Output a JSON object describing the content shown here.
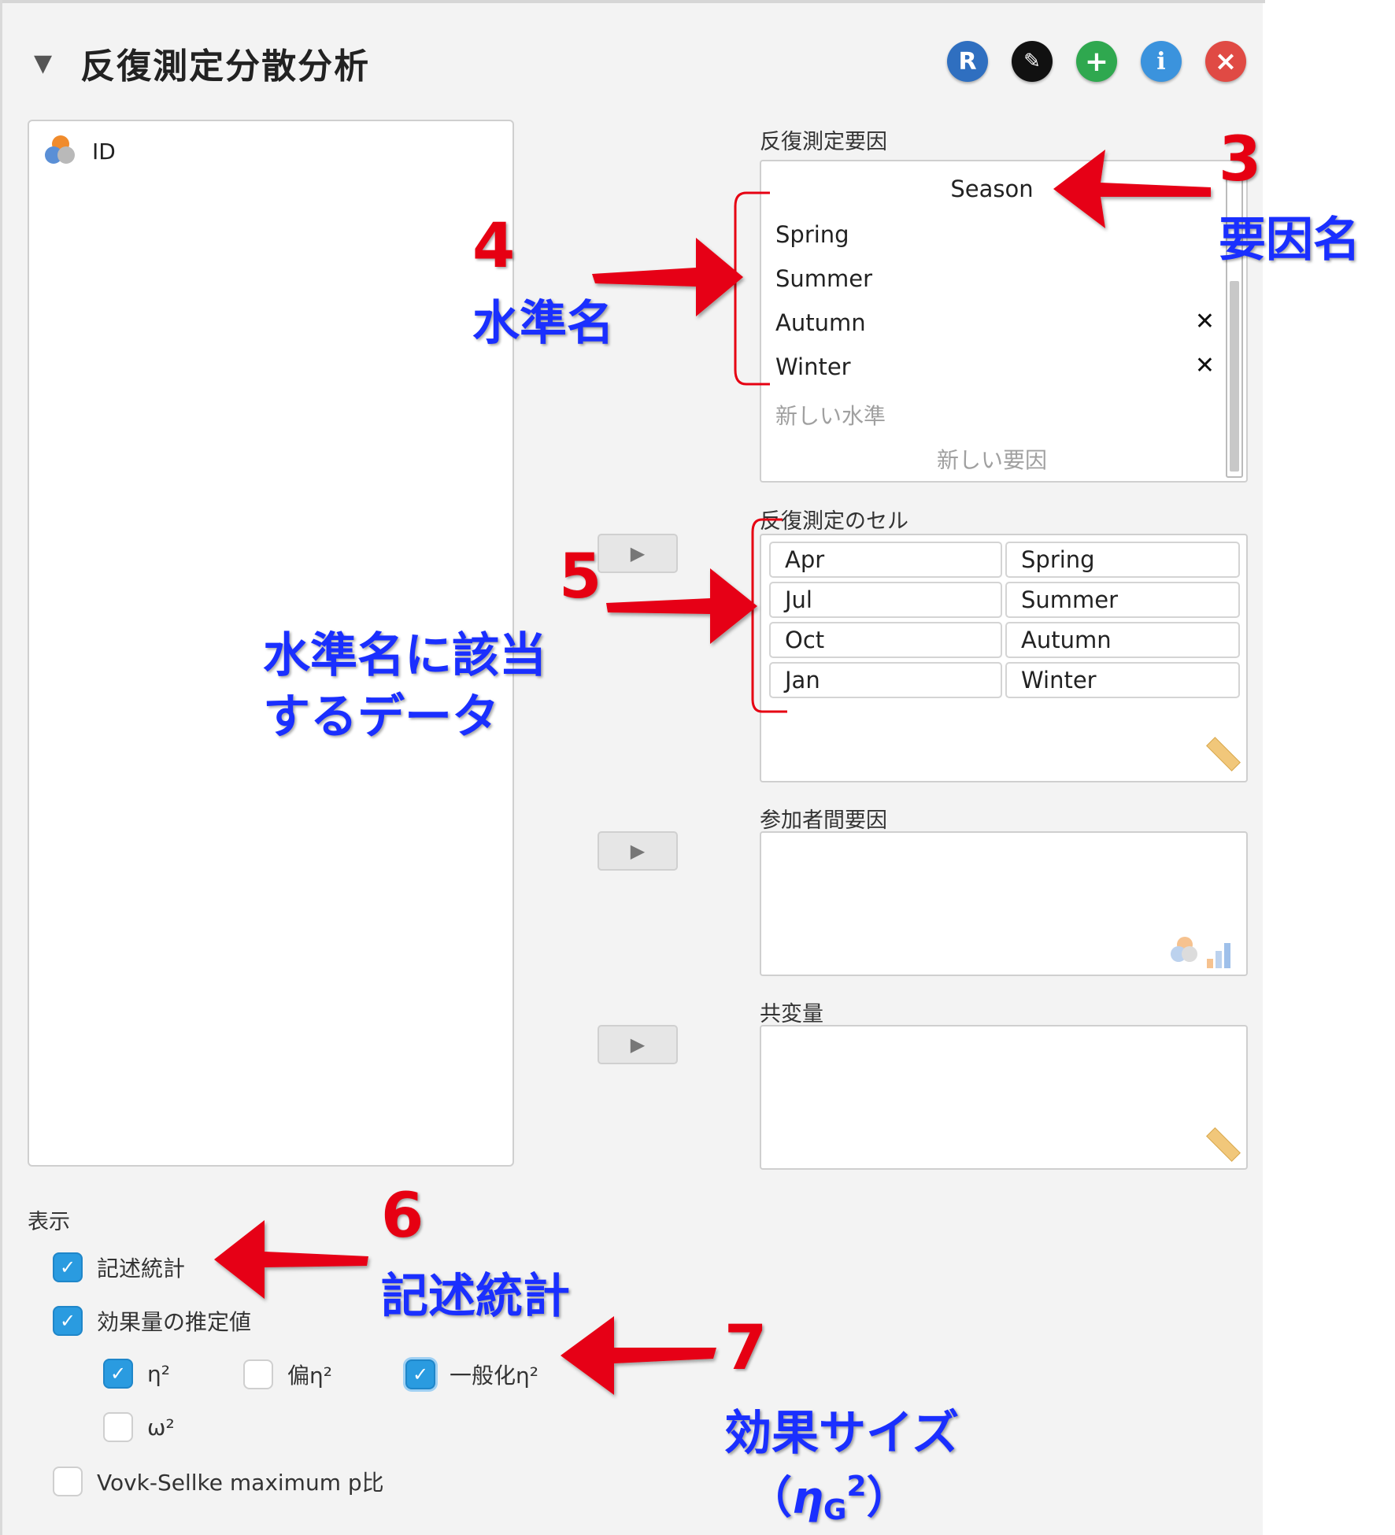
{
  "header": {
    "collapse_glyph": "▼",
    "title": "反復測定分散分析",
    "buttons": [
      {
        "label": "R",
        "icon": "r-syntax-icon",
        "color": "#2f6fc0"
      },
      {
        "label": "✎",
        "icon": "pencil-icon",
        "color": "#111111"
      },
      {
        "label": "+",
        "icon": "plus-icon",
        "color": "#2fa84f"
      },
      {
        "label": "i",
        "icon": "info-icon",
        "color": "#3b93dd"
      },
      {
        "label": "×",
        "icon": "close-icon",
        "color": "#e04a44"
      }
    ]
  },
  "variables": [
    {
      "name": "ID",
      "icon": "nominal-variable-icon"
    }
  ],
  "rm_factors": {
    "label": "反復測定要因",
    "factor_name": "Season",
    "levels": [
      "Spring",
      "Summer",
      "Autumn",
      "Winter"
    ],
    "remove_glyph": "✕",
    "new_level_placeholder": "新しい水準",
    "new_factor_placeholder": "新しい要因"
  },
  "rm_cells": {
    "label": "反復測定のセル",
    "rows": [
      {
        "data": "Apr",
        "level": "Spring"
      },
      {
        "data": "Jul",
        "level": "Summer"
      },
      {
        "data": "Oct",
        "level": "Autumn"
      },
      {
        "data": "Jan",
        "level": "Winter"
      }
    ]
  },
  "between_factors": {
    "label": "参加者間要因"
  },
  "covariates": {
    "label": "共変量"
  },
  "transfer_glyph": "▶",
  "display": {
    "label": "表示",
    "check_glyph": "✓",
    "descriptives": {
      "label": "記述統計",
      "checked": true
    },
    "effect_size": {
      "label": "効果量の推定値",
      "checked": true
    },
    "eta_sq": {
      "label": "η²",
      "checked": true
    },
    "partial_eta_sq": {
      "label": "偏η²",
      "checked": false
    },
    "general_eta_sq": {
      "label": "一般化η²",
      "checked": true
    },
    "omega_sq": {
      "label": "ω²",
      "checked": false
    },
    "vovk_sellke": {
      "label": "Vovk-Sellke maximum p比",
      "checked": false
    }
  },
  "annotations": {
    "n3": "3",
    "t3": "要因名",
    "n4": "4",
    "t4": "水準名",
    "n5": "5",
    "t5a": "水準名に該当",
    "t5b": "するデータ",
    "n6": "6",
    "t6": "記述統計",
    "n7": "7",
    "t7": "効果サイズ",
    "t7b_open": "（",
    "t7b_eta": "η",
    "t7b_sub": "G",
    "t7b_sup": "2",
    "t7b_close": "）"
  },
  "colors": {
    "annotation_red": "#e60012",
    "annotation_blue": "#1a2fff",
    "checkbox_blue": "#2a9be0"
  }
}
